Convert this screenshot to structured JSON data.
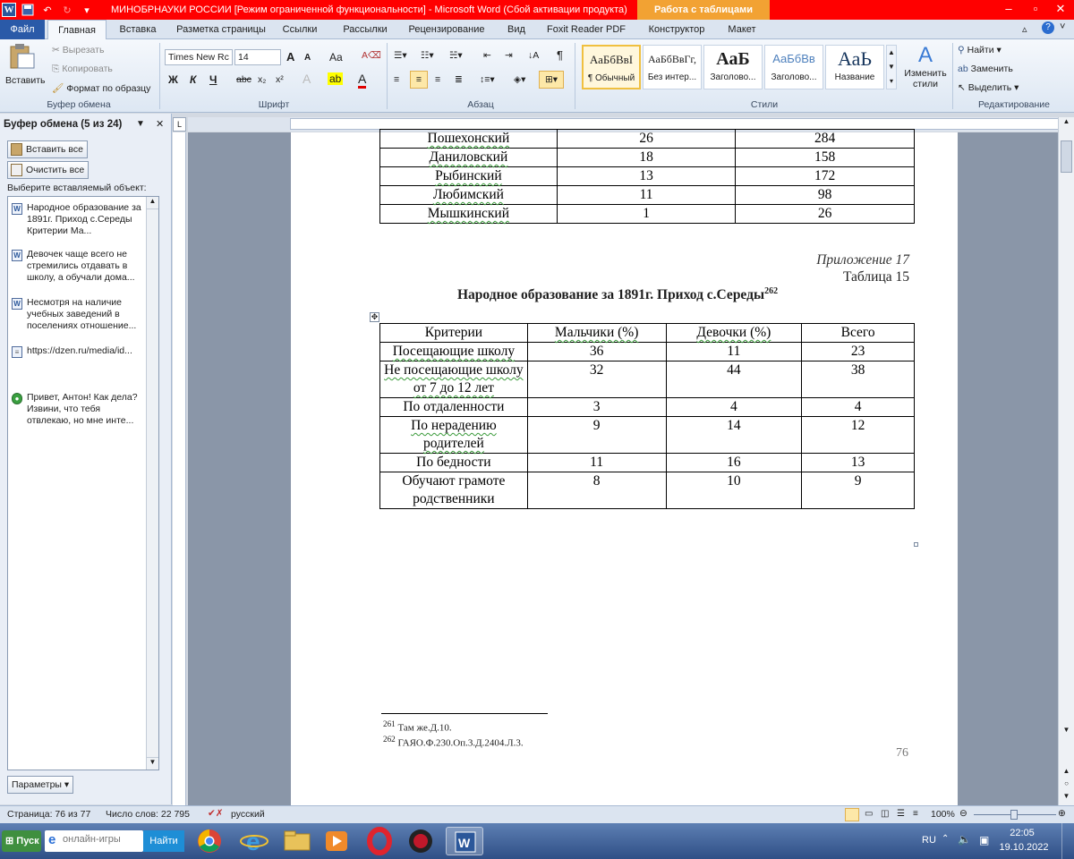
{
  "window": {
    "title": "МИНОБРНАУКИ РОССИИ [Режим ограниченной функциональности] - Microsoft Word (Сбой активации продукта)",
    "context_tab": "Работа с таблицами",
    "qat_icons": [
      "word-icon",
      "save-icon",
      "undo-icon",
      "redo-icon",
      "customize-icon"
    ]
  },
  "tabs": [
    {
      "label": "Файл"
    },
    {
      "label": "Главная"
    },
    {
      "label": "Вставка"
    },
    {
      "label": "Разметка страницы"
    },
    {
      "label": "Ссылки"
    },
    {
      "label": "Рассылки"
    },
    {
      "label": "Рецензирование"
    },
    {
      "label": "Вид"
    },
    {
      "label": "Foxit Reader PDF"
    },
    {
      "label": "Конструктор"
    },
    {
      "label": "Макет"
    }
  ],
  "ribbon": {
    "clipboard": {
      "paste": "Вставить",
      "cut": "Вырезать",
      "copy": "Копировать",
      "format_painter": "Формат по образцу",
      "group": "Буфер обмена"
    },
    "font": {
      "name": "Times New Rc",
      "size": "14",
      "group": "Шрифт",
      "bold": "Ж",
      "italic": "К",
      "underline": "Ч",
      "strike": "abc",
      "sub": "x₂",
      "sup": "x²",
      "grow": "A",
      "shrink": "A",
      "case": "Aa"
    },
    "paragraph": {
      "group": "Абзац",
      "pilcrow": "¶"
    },
    "styles": {
      "group": "Стили",
      "items": [
        {
          "sample": "АаБбВвI",
          "name": "¶ Обычный"
        },
        {
          "sample": "АаБбВвГг,",
          "name": "Без интер..."
        },
        {
          "sample": "АаБ",
          "name": "Заголово..."
        },
        {
          "sample": "АаБбВв",
          "name": "Заголово..."
        },
        {
          "sample": "АаЬ",
          "name": "Название"
        }
      ],
      "change": "Изменить стили"
    },
    "editing": {
      "group": "Редактирование",
      "find": "Найти",
      "replace": "Заменить",
      "select": "Выделить"
    }
  },
  "clipboard_pane": {
    "title": "Буфер обмена (5 из 24)",
    "paste_all": "Вставить все",
    "clear_all": "Очистить все",
    "prompt": "Выберите вставляемый объект:",
    "items": [
      {
        "text": "Народное образование за 1891г. Приход с.Середы Критерии Ма...",
        "icon": "word-doc-icon"
      },
      {
        "text": "Девочек чаще всего не стремились отдавать в школу, а обучали дома...",
        "icon": "word-doc-icon"
      },
      {
        "text": "Несмотря на наличие учебных заведений в поселениях отношение...",
        "icon": "word-doc-icon"
      },
      {
        "text": "https://dzen.ru/media/id...",
        "icon": "text-doc-icon"
      },
      {
        "text": "Привет, Антон! Как дела? Извини, что тебя отвлекаю, но мне инте...",
        "icon": "chat-icon"
      }
    ],
    "options": "Параметры"
  },
  "document": {
    "top_table": {
      "rows": [
        [
          "Пошехонский",
          "26",
          "284"
        ],
        [
          "Даниловский",
          "18",
          "158"
        ],
        [
          "Рыбинский",
          "13",
          "172"
        ],
        [
          "Любимский",
          "11",
          "98"
        ],
        [
          "Мышкинский",
          "1",
          "26"
        ]
      ]
    },
    "appendix": "Приложение 17",
    "table_number": "Таблица 15",
    "heading": "Народное образование за 1891г. Приход с.Середы",
    "heading_footnote": "262",
    "table": {
      "headers": [
        "Критерии",
        "Мальчики (%)",
        "Девочки (%)",
        "Всего"
      ],
      "rows": [
        [
          "Посещающие школу",
          "36",
          "11",
          "23"
        ],
        [
          "Не посещающие школу от 7 до 12 лет",
          "32",
          "44",
          "38"
        ],
        [
          "По отдаленности",
          "3",
          "4",
          "4"
        ],
        [
          "По нерадению родителей",
          "9",
          "14",
          "12"
        ],
        [
          "По бедности",
          "11",
          "16",
          "13"
        ],
        [
          "Обучают грамоте родственники",
          "8",
          "10",
          "9"
        ]
      ]
    },
    "footnotes": [
      {
        "num": "261",
        "text": "Там же.Д.10."
      },
      {
        "num": "262",
        "text": "ГАЯО.Ф.230.Оп.3.Д.2404.Л.3."
      }
    ],
    "page_number": "76"
  },
  "status": {
    "page": "Страница: 76 из 77",
    "words": "Число слов: 22 795",
    "lang": "русский",
    "zoom": "100%"
  },
  "taskbar": {
    "start": "Пуск",
    "search_placeholder": "онлайн-игры",
    "search_button": "Найти",
    "lang": "RU",
    "time": "22:05",
    "date": "19.10.2022"
  }
}
